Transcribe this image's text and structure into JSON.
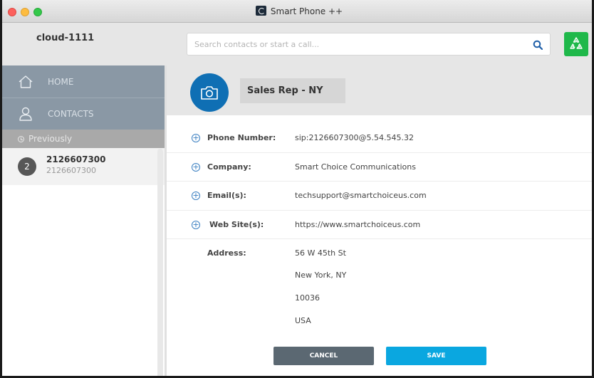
{
  "window": {
    "title": "Smart Phone ++"
  },
  "header": {
    "account": "cloud-1111",
    "search_placeholder": "Search contacts or start a call..."
  },
  "sidebar": {
    "nav": [
      {
        "label": "HOME",
        "icon": "home-icon"
      },
      {
        "label": "CONTACTS",
        "icon": "user-icon"
      }
    ],
    "section_label": "Previously",
    "recent": [
      {
        "badge": "2",
        "name": "2126607300",
        "sub": "2126607300"
      }
    ]
  },
  "contact": {
    "name": "Sales Rep - NY",
    "fields": [
      {
        "label": "Phone Number:",
        "value": "sip:2126607300@5.54.545.32"
      },
      {
        "label": "Company:",
        "value": "Smart Choice Communications"
      },
      {
        "label": "Email(s):",
        "value": "techsupport@smartchoiceus.com"
      },
      {
        "label": "Web Site(s):",
        "value": "https://www.smartchoiceus.com"
      }
    ],
    "address_label": "Address:",
    "address_lines": [
      "56 W 45th St",
      "New York, NY",
      "10036",
      "USA"
    ]
  },
  "actions": {
    "cancel": "CANCEL",
    "save": "SAVE"
  },
  "colors": {
    "accent_blue": "#0f6fb4",
    "save_button": "#0aa7e0",
    "cancel_button": "#5b6872",
    "nav_background": "#8a98a5",
    "brand_green": "#1fb84a"
  }
}
